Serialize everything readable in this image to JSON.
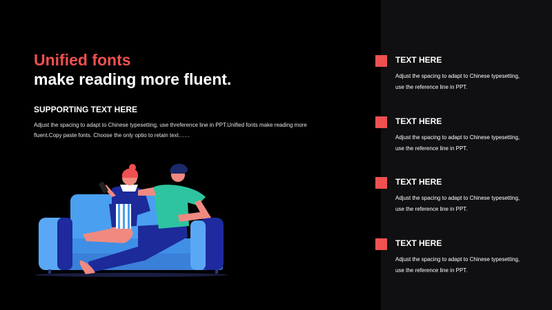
{
  "colors": {
    "accent": "#f05050",
    "background": "#000000",
    "right_panel": "#101012",
    "text": "#ffffff"
  },
  "header": {
    "title_line1": "Unified fonts",
    "title_line2": "make reading more fluent."
  },
  "intro": {
    "heading": "SUPPORTING TEXT HERE",
    "body": "Adjust the spacing to adapt to Chinese typesetting, use threference line in PPT.Unified fonts make reading more fluent.Copy paste fonts. Choose the only optio to retain text……"
  },
  "illustration": {
    "subject": "couple-on-sofa-illustration"
  },
  "items": [
    {
      "title": "TEXT HERE",
      "text": "Adjust the spacing to adapt to Chinese typesetting, use the reference line in PPT."
    },
    {
      "title": "TEXT HERE",
      "text": "Adjust the spacing to adapt to Chinese typesetting, use the reference line in PPT."
    },
    {
      "title": "TEXT HERE",
      "text": "Adjust the spacing to adapt to Chinese typesetting, use the reference line in PPT."
    },
    {
      "title": "TEXT HERE",
      "text": "Adjust the spacing to adapt to Chinese typesetting, use the reference line in PPT."
    }
  ]
}
